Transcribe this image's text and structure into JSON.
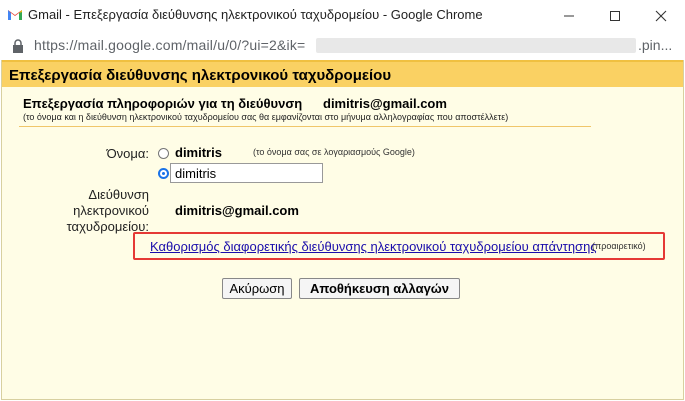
{
  "window": {
    "title": "Gmail - Επεξεργασία διεύθυνσης ηλεκτρονικού ταχυδρομείου - Google Chrome",
    "minimize_icon": "minimize-icon",
    "maximize_icon": "maximize-icon",
    "close_icon": "close-icon"
  },
  "address_bar": {
    "url_visible": "https://mail.google.com/mail/u/0/?ui=2&ik=",
    "url_tail": ".pin...",
    "icon": "lock-icon"
  },
  "dialog": {
    "title": "Επεξεργασία διεύθυνσης ηλεκτρονικού ταχυδρομείου",
    "section_heading": "Επεξεργασία πληροφοριών για τη διεύθυνση",
    "section_email": "dimitris@gmail.com",
    "section_subtitle": "(το όνομα και η διεύθυνση ηλεκτρονικού ταχυδρομείου σας θα εμφανίζονται στο μήνυμα αλληλογραφίας που αποστέλλετε)",
    "name_label": "Όνομα:",
    "account_name": "dimitris",
    "account_name_hint": "(το όνομα σας σε λογαριασμούς Google)",
    "custom_name_value": "dimitris",
    "address_label_line1": "Διεύθυνση",
    "address_label_line2": "ηλεκτρονικού",
    "address_label_line3": "ταχυδρομείου:",
    "address_value": "dimitris@gmail.com",
    "reply_to_link": "Καθορισμός διαφορετικής διεύθυνσης ηλεκτρονικού ταχυδρομείου απάντησης",
    "reply_to_optional": "(προαιρετικό)",
    "cancel_label": "Ακύρωση",
    "save_label": "Αποθήκευση αλλαγών",
    "selected_radio": "custom-name"
  },
  "colors": {
    "header_bg": "#fad163",
    "dialog_bg": "#fffde6",
    "link": "#1a0dab",
    "highlight_box": "#e53935",
    "radio_selected": "#1a73e8"
  }
}
